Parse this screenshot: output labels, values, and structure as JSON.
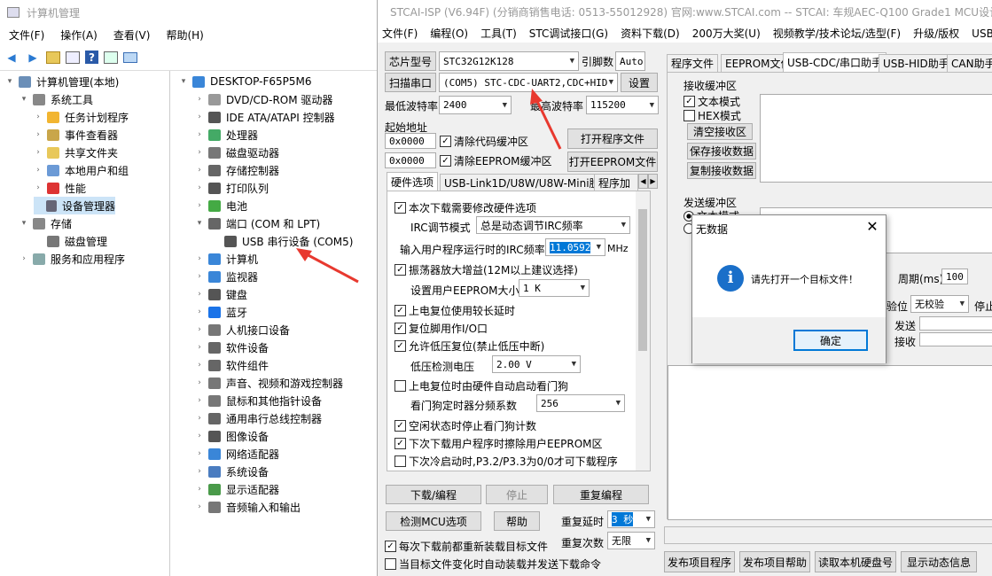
{
  "cm": {
    "title": "计算机管理",
    "menu": [
      "文件(F)",
      "操作(A)",
      "查看(V)",
      "帮助(H)"
    ],
    "left_tree": [
      {
        "label": "计算机管理(本地)",
        "icon": "computer-management-icon"
      },
      {
        "label": "系统工具",
        "icon": "tools-icon"
      },
      {
        "label": "任务计划程序",
        "icon": "clock-icon"
      },
      {
        "label": "事件查看器",
        "icon": "event-viewer-icon"
      },
      {
        "label": "共享文件夹",
        "icon": "shared-folder-icon"
      },
      {
        "label": "本地用户和组",
        "icon": "users-icon"
      },
      {
        "label": "性能",
        "icon": "performance-icon"
      },
      {
        "label": "设备管理器",
        "icon": "device-manager-icon"
      },
      {
        "label": "存储",
        "icon": "storage-icon"
      },
      {
        "label": "磁盘管理",
        "icon": "disk-icon"
      },
      {
        "label": "服务和应用程序",
        "icon": "services-icon"
      }
    ],
    "right_tree": [
      {
        "label": "DESKTOP-F65P5M6",
        "icon": "computer-icon"
      },
      {
        "label": "DVD/CD-ROM 驱动器",
        "icon": "dvd-icon"
      },
      {
        "label": "IDE ATA/ATAPI 控制器",
        "icon": "ide-icon"
      },
      {
        "label": "处理器",
        "icon": "cpu-icon"
      },
      {
        "label": "磁盘驱动器",
        "icon": "disk-icon"
      },
      {
        "label": "存储控制器",
        "icon": "storage-controller-icon"
      },
      {
        "label": "打印队列",
        "icon": "printer-icon"
      },
      {
        "label": "电池",
        "icon": "battery-icon"
      },
      {
        "label": "端口 (COM 和 LPT)",
        "icon": "port-icon"
      },
      {
        "label": "USB 串行设备 (COM5)",
        "icon": "usb-serial-icon"
      },
      {
        "label": "计算机",
        "icon": "computer-icon"
      },
      {
        "label": "监视器",
        "icon": "monitor-icon"
      },
      {
        "label": "键盘",
        "icon": "keyboard-icon"
      },
      {
        "label": "蓝牙",
        "icon": "bluetooth-icon"
      },
      {
        "label": "人机接口设备",
        "icon": "hid-icon"
      },
      {
        "label": "软件设备",
        "icon": "software-device-icon"
      },
      {
        "label": "软件组件",
        "icon": "software-component-icon"
      },
      {
        "label": "声音、视频和游戏控制器",
        "icon": "sound-icon"
      },
      {
        "label": "鼠标和其他指针设备",
        "icon": "mouse-icon"
      },
      {
        "label": "通用串行总线控制器",
        "icon": "usb-icon"
      },
      {
        "label": "图像设备",
        "icon": "camera-icon"
      },
      {
        "label": "网络适配器",
        "icon": "network-icon"
      },
      {
        "label": "系统设备",
        "icon": "system-device-icon"
      },
      {
        "label": "显示适配器",
        "icon": "display-adapter-icon"
      },
      {
        "label": "音频输入和输出",
        "icon": "audio-icon"
      }
    ]
  },
  "stc": {
    "title": "STCAI-ISP (V6.94F) (分销商销售电话: 0513-55012928) 官网:www.STCAI.com  -- STCAI: 车规AEC-Q100 Grade1 MCU设计",
    "menu": [
      "文件(F)",
      "编程(O)",
      "工具(T)",
      "STC调试接口(G)",
      "资料下载(D)",
      "200万大奖(U)",
      "视频教学/技术论坛/选型(F)",
      "升级/版权",
      "USB驱"
    ],
    "chip_label": "芯片型号",
    "chip_value": "STC32G12K128",
    "pin_label": "引脚数",
    "pin_value": "Auto",
    "scan_label": "扫描串口",
    "port_value": "(COM5) STC-CDC-UART2,CDC+HID",
    "settings_label": "设置",
    "min_baud_label": "最低波特率",
    "min_baud": "2400",
    "max_baud_label": "最高波特率",
    "max_baud": "115200",
    "start_addr_label": "起始地址",
    "addr1": "0x0000",
    "clear_code": "清除代码缓冲区",
    "addr2": "0x0000",
    "clear_eeprom": "清除EEPROM缓冲区",
    "open_prog": "打开程序文件",
    "open_eeprom": "打开EEPROM文件",
    "left_tabs": [
      "硬件选项",
      "USB-Link1D/U8W/U8W-Mini脱机",
      "程序加"
    ],
    "hw": {
      "opt1": "本次下载需要修改硬件选项",
      "irc_mode_label": "IRC调节模式",
      "irc_mode": "总是动态调节IRC频率",
      "irc_freq_label": "输入用户程序运行时的IRC频率",
      "irc_freq": "11.0592",
      "mhz": "MHz",
      "opt2": "振荡器放大增益(12M以上建议选择)",
      "eeprom_size_label": "设置用户EEPROM大小",
      "eeprom_size": "1   K",
      "opt3": "上电复位使用较长延时",
      "opt4": "复位脚用作I/O口",
      "opt5": "允许低压复位(禁止低压中断)",
      "lv_label": "低压检测电压",
      "lv": "2.00 V",
      "opt6": "上电复位时由硬件自动启动看门狗",
      "wdt_label": "看门狗定时器分频系数",
      "wdt": "256",
      "opt7": "空闲状态时停止看门狗计数",
      "opt8": "下次下载用户程序时擦除用户EEPROM区",
      "opt9": "下次冷启动时,P3.2/P3.3为0/0才可下载程序"
    },
    "download": "下载/编程",
    "stop": "停止",
    "reprog": "重复编程",
    "detect": "检测MCU选项",
    "help": "帮助",
    "repeat_delay_label": "重复延时",
    "repeat_delay": "3 秒",
    "repeat_count_label": "重复次数",
    "repeat_count": "无限",
    "reload_label": "每次下载前都重新装载目标文件",
    "auto_label": "当目标文件变化时自动装载并发送下载命令",
    "right_tabs": [
      "程序文件",
      "EEPROM文件",
      "USB-CDC/串口助手",
      "USB-HID助手",
      "CAN助手"
    ],
    "recv_label": "接收缓冲区",
    "text_mode": "文本模式",
    "hex_mode": "HEX模式",
    "clear_recv": "清空接收区",
    "save_recv": "保存接收数据",
    "copy_recv": "复制接收数据",
    "send_label": "发送缓冲区",
    "send_text": "文本模式",
    "period_label": "周期(ms)",
    "period": "100",
    "check_label": "验位",
    "check_value": "无校验",
    "stop_label": "停止",
    "send_count": "发送",
    "recv_count": "接收",
    "bottom_btns": [
      "发布项目程序",
      "发布项目帮助",
      "读取本机硬盘号",
      "显示动态信息"
    ]
  },
  "dialog": {
    "title": "无数据",
    "message": "请先打开一个目标文件！",
    "ok": "确定"
  },
  "colors": {
    "arrow": "#e8392f",
    "accent": "#0078d7"
  }
}
